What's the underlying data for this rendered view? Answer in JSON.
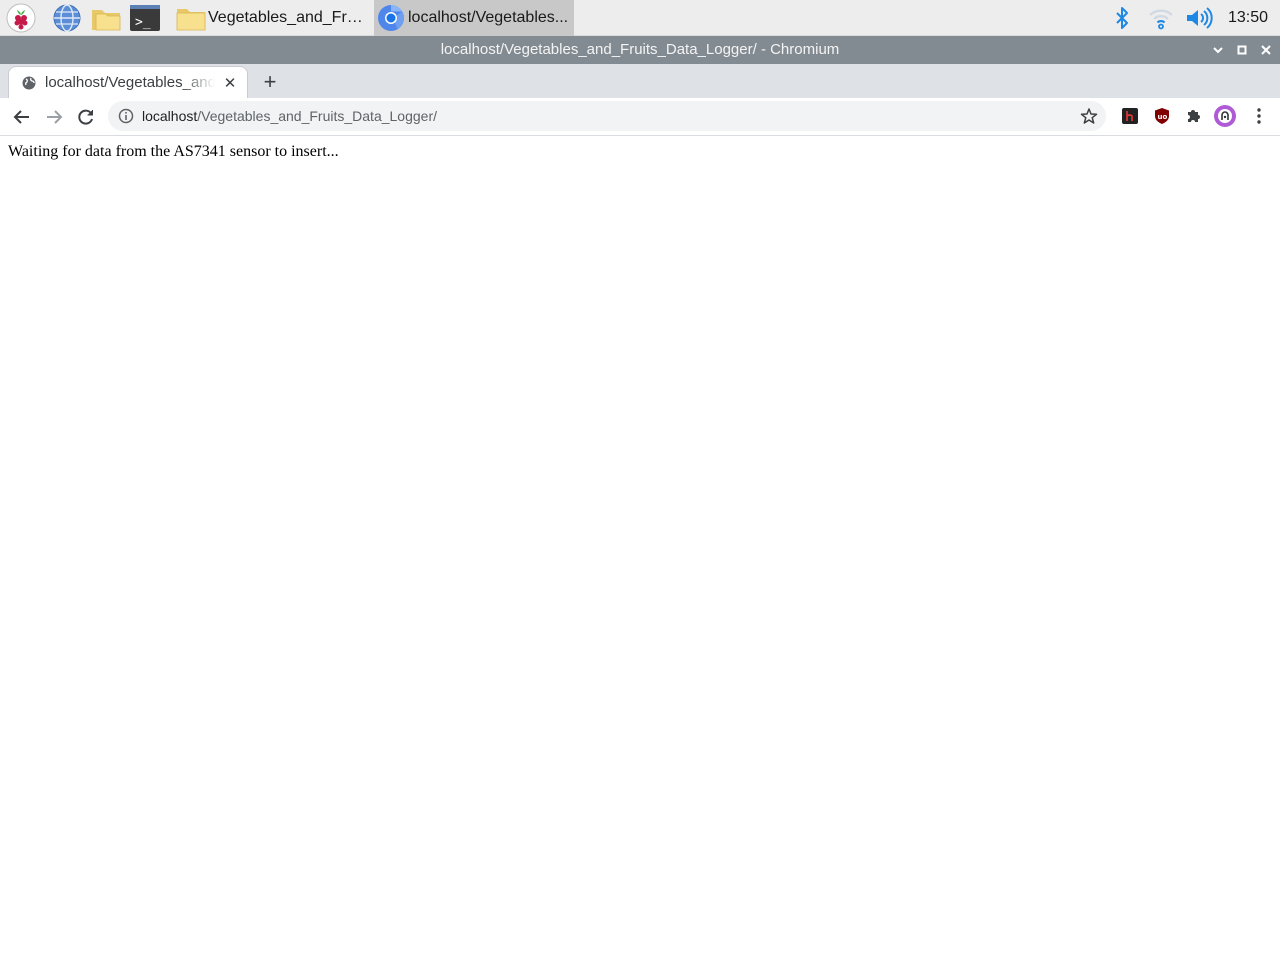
{
  "taskbar": {
    "launchers": [
      {
        "icon": "raspberry-menu-icon"
      },
      {
        "icon": "web-browser-icon"
      },
      {
        "icon": "file-manager-icon"
      },
      {
        "icon": "terminal-icon"
      }
    ],
    "tasks": [
      {
        "icon": "folder-icon",
        "label": "Vegetables_and_Fruit..."
      },
      {
        "icon": "chromium-icon",
        "label": "localhost/Vegetables..."
      }
    ],
    "tray": {
      "icons": [
        "bluetooth-icon",
        "wifi-icon",
        "volume-icon"
      ],
      "clock": "13:50"
    }
  },
  "window": {
    "title": "localhost/Vegetables_and_Fruits_Data_Logger/ - Chromium"
  },
  "browser": {
    "tab": {
      "title": "localhost/Vegetables_and_Fruits_Data_Logger/",
      "close_glyph": "✕"
    },
    "new_tab_glyph": "+",
    "omnibox": {
      "host": "localhost",
      "path": "/Vegetables_and_Fruits_Data_Logger/"
    },
    "extensions": [
      "hiragana-extension-icon",
      "ublock-origin-icon",
      "extensions-puzzle-icon",
      "profile-avatar-icon"
    ]
  },
  "page": {
    "message": "Waiting for data from the AS7341 sensor to insert..."
  },
  "colors": {
    "titlebar": "#838b92",
    "tabstrip": "#dee1e6",
    "omnibox": "#f1f3f4",
    "accent_blue": "#1a73e8",
    "tray_blue": "#1e88e5"
  }
}
